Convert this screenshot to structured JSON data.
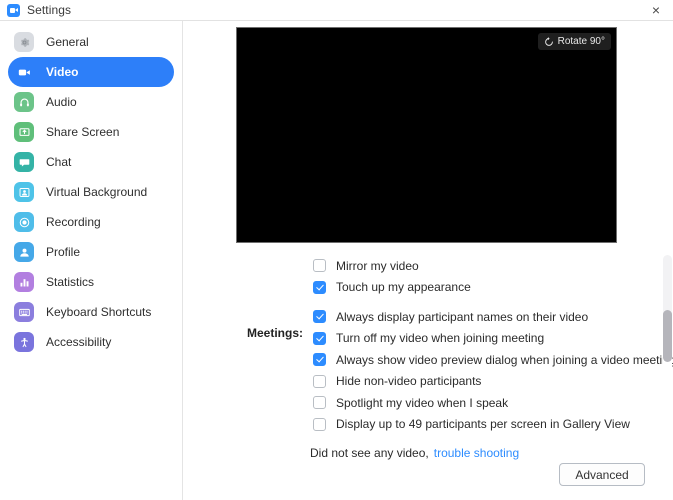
{
  "window": {
    "title": "Settings",
    "title_icon": "zoom-camera-icon",
    "close_label": "×"
  },
  "sidebar": {
    "items": [
      {
        "label": "General",
        "icon": "gear-icon",
        "color": "#d9dce1",
        "glyph": "#8a8f96",
        "active": false
      },
      {
        "label": "Video",
        "icon": "video-camera-icon",
        "color": "#ffffff",
        "glyph": "#2d7ff9",
        "active": true
      },
      {
        "label": "Audio",
        "icon": "headphones-icon",
        "color": "#6cc489",
        "glyph": "#ffffff",
        "active": false
      },
      {
        "label": "Share Screen",
        "icon": "screen-share-icon",
        "color": "#5fbf7a",
        "glyph": "#ffffff",
        "active": false
      },
      {
        "label": "Chat",
        "icon": "chat-bubble-icon",
        "color": "#34b3a6",
        "glyph": "#ffffff",
        "active": false
      },
      {
        "label": "Virtual Background",
        "icon": "person-frame-icon",
        "color": "#4ec3e8",
        "glyph": "#ffffff",
        "active": false
      },
      {
        "label": "Recording",
        "icon": "record-circle-icon",
        "color": "#4fbde9",
        "glyph": "#ffffff",
        "active": false
      },
      {
        "label": "Profile",
        "icon": "person-icon",
        "color": "#45a8e8",
        "glyph": "#ffffff",
        "active": false
      },
      {
        "label": "Statistics",
        "icon": "bar-chart-icon",
        "color": "#b27fe0",
        "glyph": "#ffffff",
        "active": false
      },
      {
        "label": "Keyboard Shortcuts",
        "icon": "keyboard-icon",
        "color": "#8b7ede",
        "glyph": "#ffffff",
        "active": false
      },
      {
        "label": "Accessibility",
        "icon": "accessibility-icon",
        "color": "#7a74dd",
        "glyph": "#ffffff",
        "active": false
      }
    ]
  },
  "video": {
    "preview_state": "black",
    "rotate_button": {
      "label": "Rotate 90°",
      "icon": "rotate-counterclockwise-icon"
    }
  },
  "options": {
    "group_label": "Meetings:",
    "items": [
      {
        "label": "Mirror my video",
        "checked": false,
        "group": false
      },
      {
        "label": "Touch up my appearance",
        "checked": true,
        "group": false
      },
      {
        "label": "Always display participant names on their video",
        "checked": true,
        "group": true
      },
      {
        "label": "Turn off my video when joining meeting",
        "checked": true,
        "group": false
      },
      {
        "label": "Always show video preview dialog when joining a video meeting",
        "checked": true,
        "group": false
      },
      {
        "label": "Hide non-video participants",
        "checked": false,
        "group": false
      },
      {
        "label": "Spotlight my video when I speak",
        "checked": false,
        "group": false
      },
      {
        "label": "Display up to 49 participants per screen in Gallery View",
        "checked": false,
        "group": false
      }
    ]
  },
  "trouble": {
    "static_text": "Did not see any video,",
    "link_text": "trouble shooting"
  },
  "footer": {
    "advanced_label": "Advanced"
  },
  "colors": {
    "accent": "#2d8cff",
    "active_nav": "#2d7ff9",
    "link": "#2d8cff",
    "scroll_thumb": "#b5b5bb"
  }
}
